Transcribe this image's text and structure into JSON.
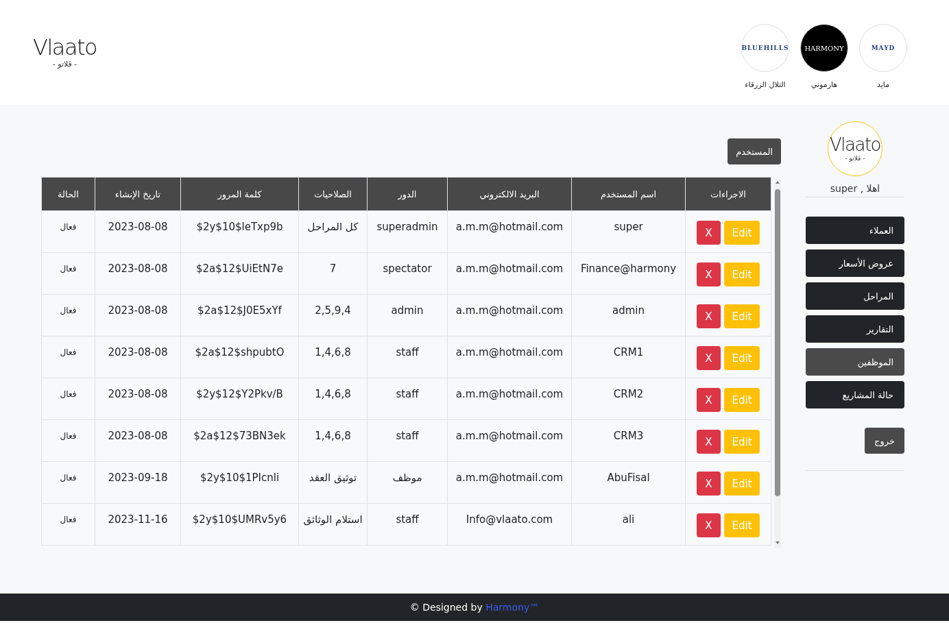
{
  "header": {
    "logo": {
      "name": "Vlaato",
      "subtitle": "- ڤلاتو -"
    },
    "partners": [
      {
        "logo_text": "MAYD",
        "label": "مايد",
        "dark": false
      },
      {
        "logo_text": "HARMONY",
        "label": "هارموني",
        "dark": true
      },
      {
        "logo_text": "BLUEHILLS",
        "label": "التلال الزرقاء",
        "dark": false
      }
    ]
  },
  "sidebar": {
    "logo": {
      "name": "Vlaato",
      "subtitle": "- ڤلاتو -"
    },
    "greeting": "اهلا , super",
    "items": [
      {
        "label": "العملاء",
        "selected": false
      },
      {
        "label": "عروض الأسعار",
        "selected": false
      },
      {
        "label": "المراحل",
        "selected": false
      },
      {
        "label": "التقارير",
        "selected": false
      },
      {
        "label": "الموظفين",
        "selected": true
      },
      {
        "label": "حالة المشاريع",
        "selected": false
      }
    ],
    "logout": "خروج"
  },
  "users_button": "المستخدم",
  "table": {
    "columns": [
      "الاجراءات",
      "اسم المستخدم",
      "البريد الالكتروني",
      "الدور",
      "الصلاحيات",
      "كلمة المرور",
      "تاريخ الإنشاء",
      "الحالة"
    ],
    "rows": [
      {
        "edit": "Edit",
        "delete": "X",
        "username": "super",
        "email": "a.m.m@hotmail.com",
        "role": "superadmin",
        "permissions": "كل المراحل",
        "password": "$2y$10$leTxp9b",
        "created": "2023-08-08",
        "status": "فعال"
      },
      {
        "edit": "Edit",
        "delete": "X",
        "username": "Finance@harmony",
        "email": "a.m.m@hotmail.com",
        "role": "spectator",
        "permissions": "7",
        "password": "$2a$12$UiEtN7e",
        "created": "2023-08-08",
        "status": "فعال"
      },
      {
        "edit": "Edit",
        "delete": "X",
        "username": "admin",
        "email": "a.m.m@hotmail.com",
        "role": "admin",
        "permissions": "2,5,9,4",
        "password": "$2a$12$J0E5xYf",
        "created": "2023-08-08",
        "status": "فعال"
      },
      {
        "edit": "Edit",
        "delete": "X",
        "username": "CRM1",
        "email": "a.m.m@hotmail.com",
        "role": "staff",
        "permissions": "1,4,6,8",
        "password": "$2a$12$shpubtO",
        "created": "2023-08-08",
        "status": "فعال"
      },
      {
        "edit": "Edit",
        "delete": "X",
        "username": "CRM2",
        "email": "a.m.m@hotmail.com",
        "role": "staff",
        "permissions": "1,4,6,8",
        "password": "$2y$12$Y2Pkv/B",
        "created": "2023-08-08",
        "status": "فعال"
      },
      {
        "edit": "Edit",
        "delete": "X",
        "username": "CRM3",
        "email": "a.m.m@hotmail.com",
        "role": "staff",
        "permissions": "1,4,6,8",
        "password": "$2a$12$73BN3ek",
        "created": "2023-08-08",
        "status": "فعال"
      },
      {
        "edit": "Edit",
        "delete": "X",
        "username": "AbuFisal",
        "email": "a.m.m@hotmail.com",
        "role": "موظف",
        "permissions": "توثيق العقد",
        "password": "$2y$10$1PIcnli",
        "created": "2023-09-18",
        "status": "فعال"
      },
      {
        "edit": "Edit",
        "delete": "X",
        "username": "ali",
        "email": "Info@vlaato.com",
        "role": "staff",
        "permissions": "استلام الوثائق",
        "password": "$2y$10$UMRv5y6",
        "created": "2023-11-16",
        "status": "فعال"
      }
    ]
  },
  "footer": {
    "text": "© Designed by ",
    "link": "Harmony™"
  }
}
